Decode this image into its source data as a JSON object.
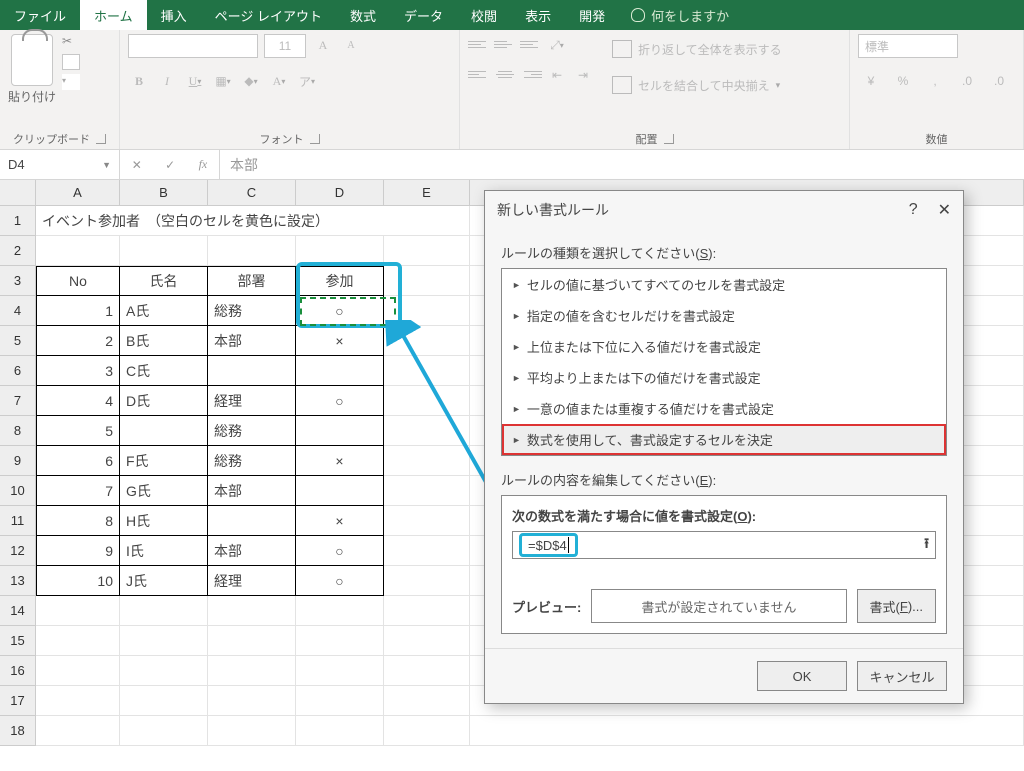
{
  "tabs": {
    "file": "ファイル",
    "home": "ホーム",
    "insert": "挿入",
    "page_layout": "ページ レイアウト",
    "formulas": "数式",
    "data": "データ",
    "review": "校閲",
    "view": "表示",
    "developer": "開発",
    "tell_me": "何をしますか"
  },
  "ribbon": {
    "clipboard": {
      "paste": "貼り付け",
      "group": "クリップボード"
    },
    "font": {
      "size": "11",
      "group": "フォント"
    },
    "alignment": {
      "wrap": "折り返して全体を表示する",
      "merge": "セルを結合して中央揃え",
      "group": "配置"
    },
    "number": {
      "format": "標準",
      "group": "数値"
    }
  },
  "namebox": "D4",
  "formula_bar": "本部",
  "columns": [
    "A",
    "B",
    "C",
    "D",
    "E"
  ],
  "title_cell": "イベント参加者　（空白のセルを黄色に設定）",
  "headers": {
    "no": "No",
    "name": "氏名",
    "dept": "部署",
    "join": "参加"
  },
  "rows": [
    {
      "no": "1",
      "name": "A氏",
      "dept": "総務",
      "join": "○"
    },
    {
      "no": "2",
      "name": "B氏",
      "dept": "本部",
      "join": "×"
    },
    {
      "no": "3",
      "name": "C氏",
      "dept": "",
      "join": ""
    },
    {
      "no": "4",
      "name": "D氏",
      "dept": "経理",
      "join": "○"
    },
    {
      "no": "5",
      "name": "",
      "dept": "総務",
      "join": ""
    },
    {
      "no": "6",
      "name": "F氏",
      "dept": "総務",
      "join": "×"
    },
    {
      "no": "7",
      "name": "G氏",
      "dept": "本部",
      "join": ""
    },
    {
      "no": "8",
      "name": "H氏",
      "dept": "",
      "join": "×"
    },
    {
      "no": "9",
      "name": "I氏",
      "dept": "本部",
      "join": "○"
    },
    {
      "no": "10",
      "name": "J氏",
      "dept": "経理",
      "join": "○"
    }
  ],
  "dialog": {
    "title": "新しい書式ルール",
    "help": "?",
    "close": "✕",
    "select_type_label": "ルールの種類を選択してください(",
    "select_type_mn": "S",
    "select_type_tail": "):",
    "types": [
      "セルの値に基づいてすべてのセルを書式設定",
      "指定の値を含むセルだけを書式設定",
      "上位または下位に入る値だけを書式設定",
      "平均より上または下の値だけを書式設定",
      "一意の値または重複する値だけを書式設定",
      "数式を使用して、書式設定するセルを決定"
    ],
    "edit_label": "ルールの内容を編集してください(",
    "edit_mn": "E",
    "edit_tail": "):",
    "formula_label_pre": "次の数式を満たす場合に値を書式設定(",
    "formula_label_mn": "O",
    "formula_label_tail": "):",
    "formula_value": "=$D$4",
    "preview_label": "プレビュー:",
    "preview_text": "書式が設定されていません",
    "format_btn_pre": "書式(",
    "format_btn_mn": "F",
    "format_btn_tail": ")...",
    "ok": "OK",
    "cancel": "キャンセル"
  }
}
